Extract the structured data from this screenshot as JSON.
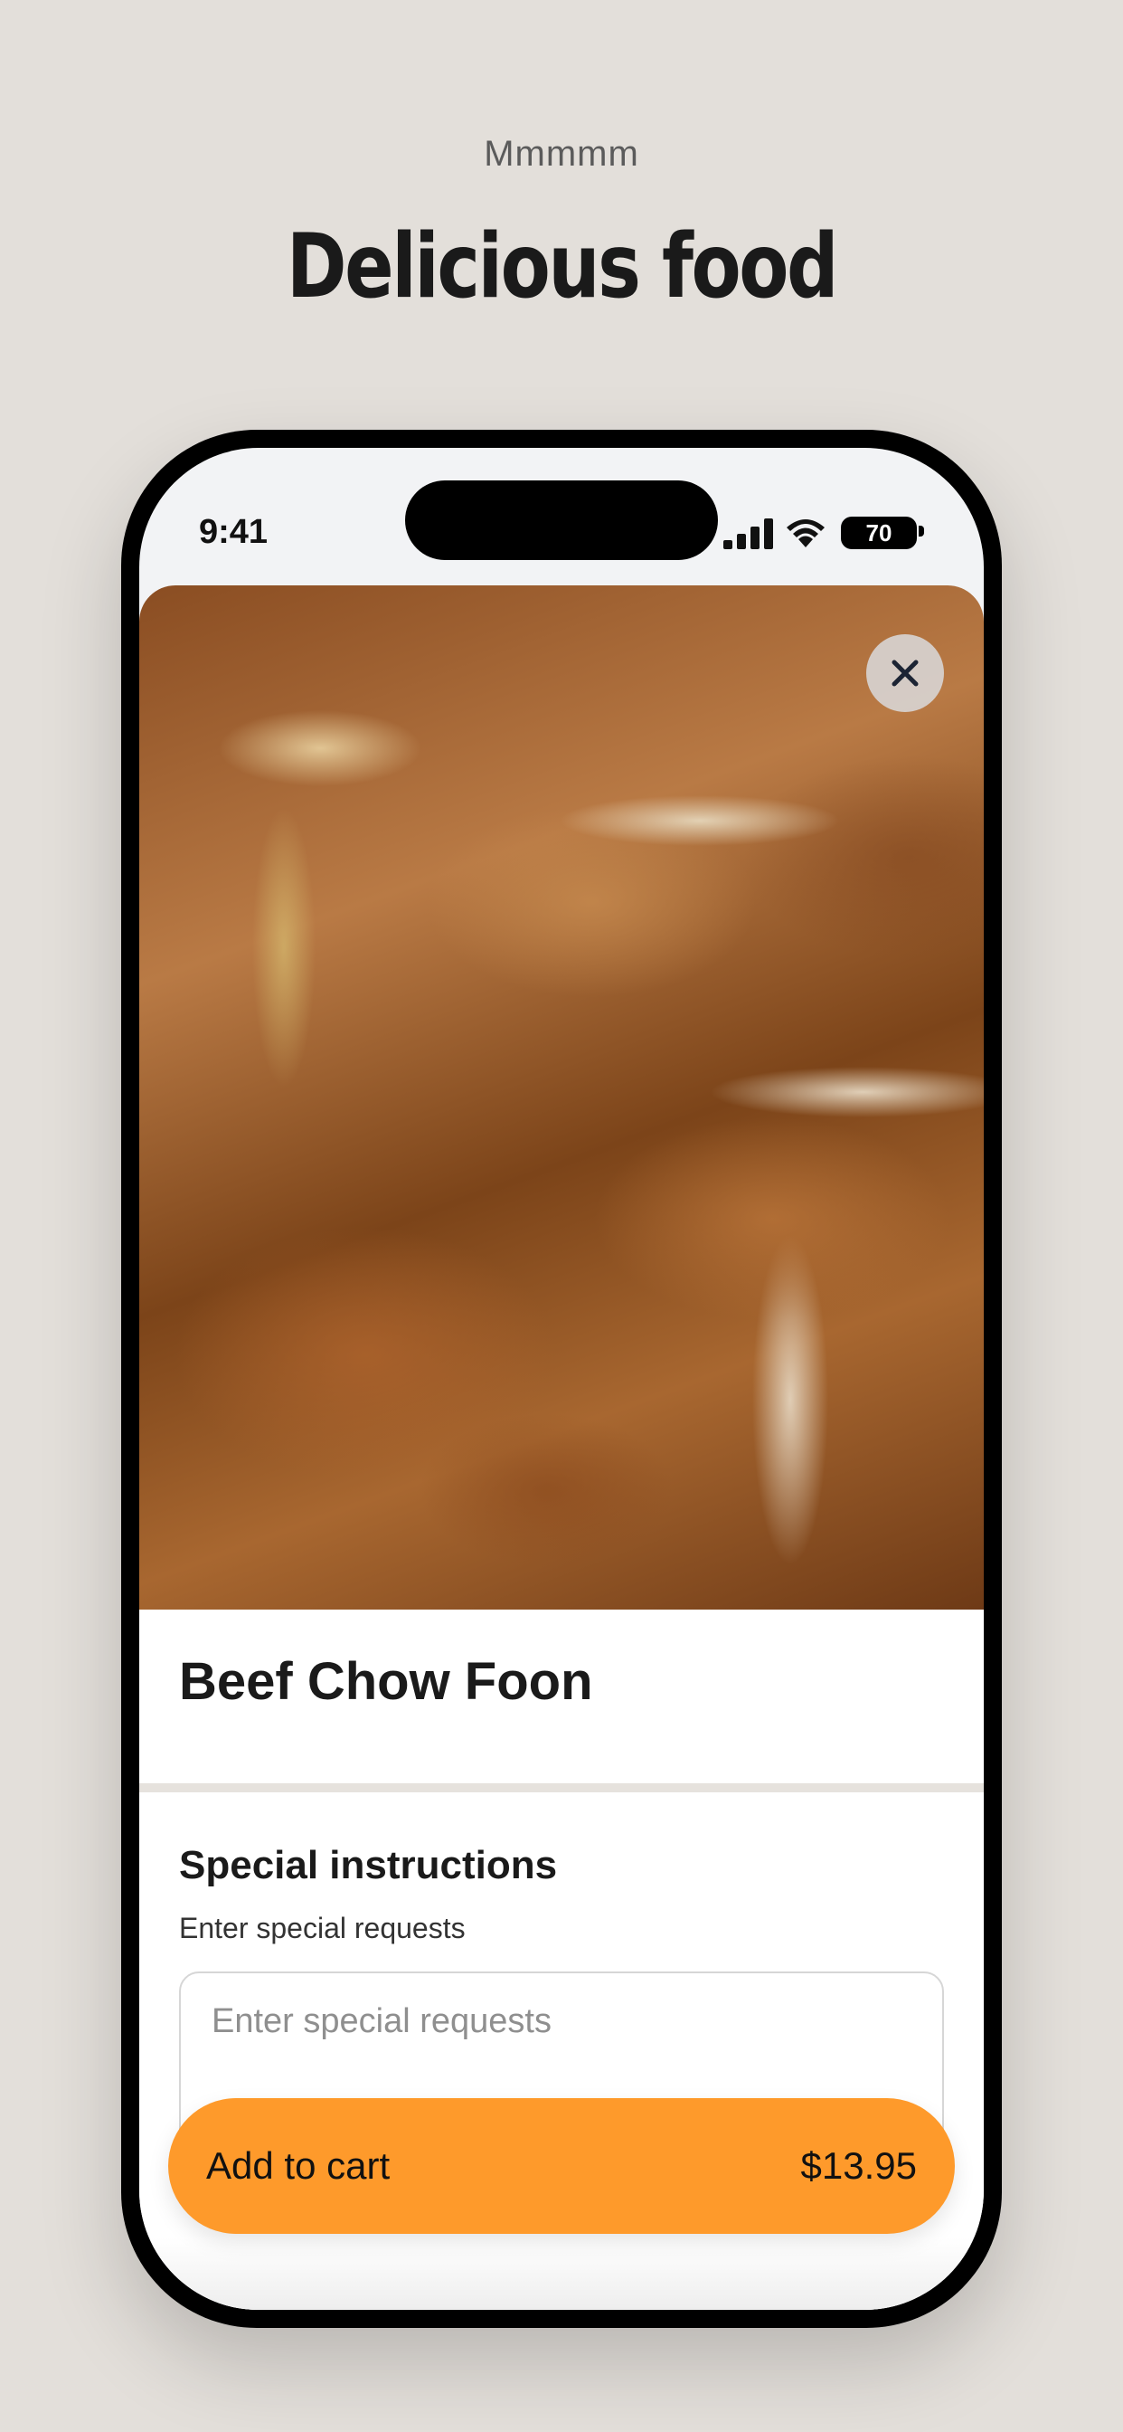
{
  "header": {
    "eyebrow": "Mmmmm",
    "headline": "Delicious food"
  },
  "status_bar": {
    "time": "9:41",
    "battery": "70",
    "icons": [
      "signal-icon",
      "wifi-icon",
      "battery-icon"
    ]
  },
  "item": {
    "image": "food-photo",
    "close_icon": "close-icon",
    "title": "Beef Chow Foon"
  },
  "special_instructions": {
    "title": "Special instructions",
    "subtitle": "Enter special requests",
    "placeholder": "Enter special requests",
    "value": ""
  },
  "cart_button": {
    "label": "Add to cart",
    "price": "$13.95"
  },
  "colors": {
    "background": "#e3dfda",
    "accent": "#fe9a2b",
    "phone_frame": "#000000"
  }
}
